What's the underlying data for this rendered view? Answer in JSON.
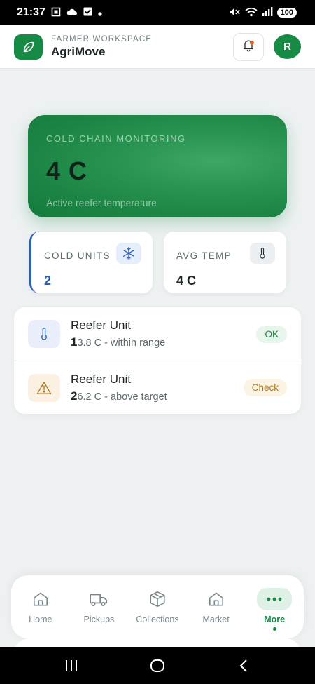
{
  "status_bar": {
    "time": "21:37",
    "battery": "100",
    "left_icons": [
      "screenshot-icon",
      "cloud-icon",
      "check-square-icon",
      "dot-icon"
    ],
    "right_icons": [
      "mute-icon",
      "wifi-icon",
      "signal-icon"
    ]
  },
  "header": {
    "subtitle": "FARMER WORKSPACE",
    "title": "AgriMove",
    "avatar_initial": "R",
    "notification_badge": true
  },
  "hero": {
    "label": "COLD CHAIN MONITORING",
    "value": "4 C",
    "caption": "Active reefer temperature"
  },
  "stats": [
    {
      "label": "COLD UNITS",
      "value": "2",
      "icon": "snowflake-icon",
      "accent": "#2c5fb8"
    },
    {
      "label": "AVG TEMP",
      "value": "4 C",
      "icon": "thermometer-icon"
    }
  ],
  "units": [
    {
      "title": "Reefer Unit",
      "number": "1",
      "detail": "3.8 C - within range",
      "status": "OK",
      "icon": "thermometer-icon"
    },
    {
      "title": "Reefer Unit",
      "number": "2",
      "detail": "6.2 C - above target",
      "status": "Check",
      "icon": "warning-icon"
    }
  ],
  "nav": {
    "items": [
      {
        "label": "Home",
        "icon": "home-icon"
      },
      {
        "label": "Pickups",
        "icon": "truck-icon"
      },
      {
        "label": "Collections",
        "icon": "box-icon"
      },
      {
        "label": "Market",
        "icon": "home-icon"
      },
      {
        "label": "More",
        "icon": "more-icon",
        "active": true
      }
    ]
  },
  "colors": {
    "brand": "#178a45",
    "accent_blue": "#2c5fb8",
    "ok": "#1b7e40",
    "warning": "#b07a20"
  }
}
